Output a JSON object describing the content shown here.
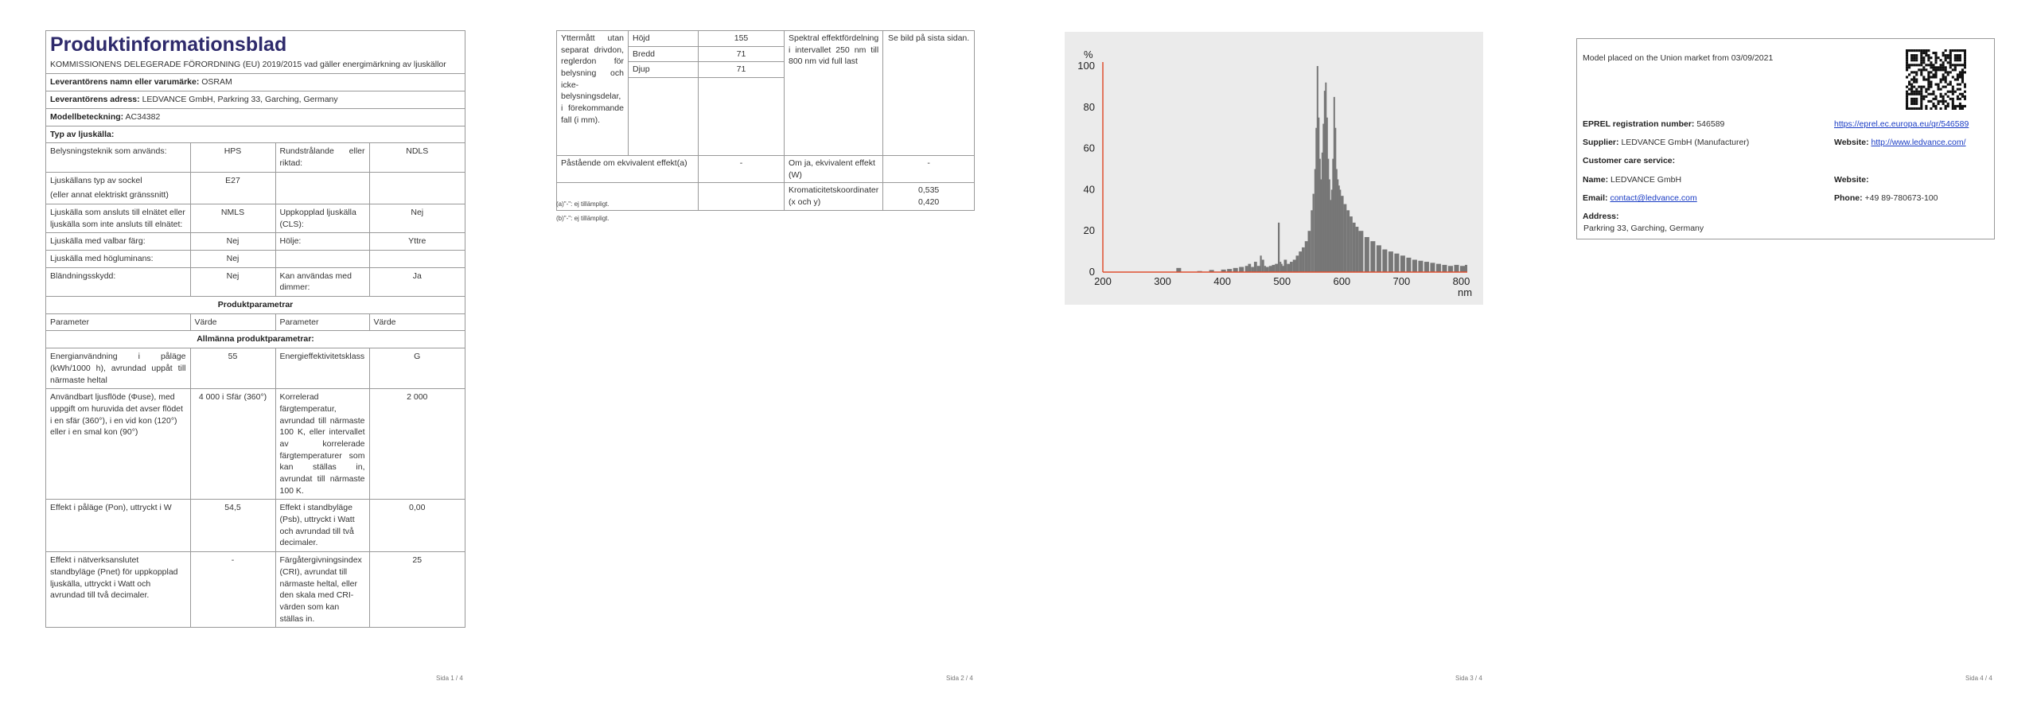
{
  "page1": {
    "title": "Produktinformationsblad",
    "intro": "KOMMISSIONENS DELEGERADE FÖRORDNING (EU) 2019/2015 vad gäller energimärkning av ljuskällor",
    "supplier_label": "Leverantörens namn eller varumärke:",
    "supplier_value": "OSRAM",
    "address_label": "Leverantörens adress:",
    "address_value": "LEDVANCE GmbH, Parkring 33, Garching, Germany",
    "model_label": "Modellbeteckning:",
    "model_value": "AC34382",
    "type_heading": "Typ av ljuskälla:",
    "type_rows": [
      {
        "l1": "Belysningsteknik som används:",
        "v1": "HPS",
        "l2": "Rundstrålande eller riktad:",
        "v2": "NDLS"
      },
      {
        "l1": "Ljuskällans typ av sockel",
        "l1b": "(eller annat elektriskt gränssnitt)",
        "v1": "E27",
        "l2": "",
        "v2": ""
      },
      {
        "l1": "Ljuskälla som ansluts till elnätet eller ljuskälla som inte ansluts till elnätet:",
        "v1": "NMLS",
        "l2": "Uppkopplad ljuskälla (CLS):",
        "v2": "Nej"
      },
      {
        "l1": "Ljuskälla med valbar färg:",
        "v1": "Nej",
        "l2": "Hölje:",
        "v2": "Yttre"
      },
      {
        "l1": "Ljuskälla med högluminans:",
        "v1": "Nej",
        "l2": "",
        "v2": ""
      },
      {
        "l1": "Bländningsskydd:",
        "v1": "Nej",
        "l2": "Kan användas med dimmer:",
        "v2": "Ja"
      }
    ],
    "params_heading": "Produktparametrar",
    "col_param": "Parameter",
    "col_value": "Värde",
    "general_heading": "Allmänna produktparametrar:",
    "param_rows": [
      {
        "l1": "Energianvändning i påläge (kWh/1000 h), avrundad uppåt till närmaste heltal",
        "v1": "55",
        "l2": "Energieffektivitetsklass",
        "v2": "G"
      },
      {
        "l1": "Användbart ljusflöde (Φuse), med uppgift om huruvida det avser flödet i en sfär (360°), i en vid kon (120°) eller i en smal kon (90°)",
        "v1": "4 000 i Sfär (360°)",
        "l2": "Korrelerad färgtemperatur, avrundad till närmaste 100 K, eller intervallet av korrelerade färgtemperaturer som kan ställas in, avrundat till närmaste 100 K.",
        "v2": "2 000"
      },
      {
        "l1": "Effekt i påläge (Pon), uttryckt i W",
        "v1": "54,5",
        "l2": "Effekt i standbyläge (Psb), uttryckt i Watt och avrundad till två decimaler.",
        "v2": "0,00"
      },
      {
        "l1": "Effekt i nätverksanslutet standbyläge (Pnet) för uppkopplad ljuskälla, uttryckt i Watt och avrundad till två decimaler.",
        "v1": "-",
        "l2": "Färgåtergivningsindex (CRI), avrundat till närmaste heltal, eller den skala med CRI-värden som kan ställas in.",
        "v2": "25"
      }
    ],
    "page_number": "Sida 1 / 4"
  },
  "page2": {
    "dims_label": "Yttermått utan separat drivdon, reglerdon för belysning och icke-belysningsdelar, i förekommande fall (i mm).",
    "dims": [
      {
        "name": "Höjd",
        "value": "155"
      },
      {
        "name": "Bredd",
        "value": "71"
      },
      {
        "name": "Djup",
        "value": "71"
      }
    ],
    "spectral_label": "Spektral effektfördelning i intervallet 250 nm till 800 nm vid full last",
    "spectral_value": "Se bild på sista sidan.",
    "equiv_claim_label": "Påstående om ekvivalent effekt(a)",
    "equiv_claim_value": "-",
    "equiv_power_label": "Om ja, ekvivalent effekt (W)",
    "equiv_power_value": "-",
    "chroma_label": "Kromaticitetskoordinater (x och y)",
    "chroma_x": "0,535",
    "chroma_y": "0,420",
    "footnote_a": "(a)\"-\": ej tillämpligt.",
    "footnote_b": "(b)\"-\": ej tillämpligt.",
    "page_number": "Sida 2 / 4"
  },
  "chart_data": {
    "type": "area",
    "title": "",
    "xlabel": "nm",
    "ylabel": "%",
    "xlim": [
      200,
      810
    ],
    "ylim": [
      0,
      100
    ],
    "xticks": [
      200,
      300,
      400,
      500,
      600,
      700,
      800
    ],
    "yticks": [
      0,
      20,
      40,
      60,
      80,
      100
    ],
    "grid": false,
    "x": [
      325,
      360,
      380,
      400,
      410,
      420,
      430,
      440,
      445,
      450,
      455,
      460,
      465,
      468,
      472,
      475,
      480,
      485,
      490,
      495,
      498,
      500,
      502,
      505,
      510,
      515,
      520,
      525,
      530,
      535,
      540,
      545,
      550,
      553,
      556,
      558,
      560,
      562,
      564,
      566,
      568,
      570,
      572,
      574,
      576,
      578,
      580,
      582,
      584,
      586,
      588,
      590,
      592,
      594,
      596,
      598,
      600,
      605,
      610,
      615,
      620,
      625,
      630,
      640,
      650,
      660,
      670,
      680,
      690,
      700,
      710,
      720,
      730,
      740,
      750,
      760,
      770,
      780,
      790,
      800,
      808
    ],
    "values": [
      2,
      0.5,
      1,
      1.2,
      1.5,
      2,
      2.5,
      3,
      4,
      2.5,
      5,
      3,
      8,
      6,
      3,
      2.5,
      3,
      3.5,
      4,
      24,
      5,
      4,
      3,
      6,
      4,
      5,
      6,
      8,
      10,
      12,
      15,
      20,
      30,
      38,
      50,
      70,
      100,
      75,
      55,
      45,
      58,
      72,
      88,
      92,
      75,
      55,
      45,
      35,
      40,
      55,
      85,
      70,
      50,
      45,
      42,
      40,
      37,
      33,
      30,
      27,
      24,
      22,
      20,
      17,
      15,
      13,
      11,
      10,
      9,
      8,
      7,
      6,
      5.5,
      5,
      4.5,
      4,
      3.5,
      3,
      3.5,
      3,
      3.5
    ],
    "color": "#777777",
    "axis_color": "#e05030"
  },
  "page3": {
    "page_number": "Sida 3 / 4"
  },
  "page4": {
    "placed": "Model placed on the Union market from 03/09/2021",
    "eprel_label": "EPREL registration number:",
    "eprel_value": "546589",
    "eprel_url": "https://eprel.ec.europa.eu/qr/546589",
    "supplier_label": "Supplier:",
    "supplier_value": "LEDVANCE GmbH (Manufacturer)",
    "website_label": "Website:",
    "website_value": "http://www.ledvance.com/",
    "care_heading": "Customer care service:",
    "name_label": "Name:",
    "name_value": "LEDVANCE GmbH",
    "care_website_label": "Website:",
    "email_label": "Email:",
    "email_value": "contact@ledvance.com",
    "phone_label": "Phone:",
    "phone_value": "+49 89-780673-100",
    "address_label": "Address:",
    "address_value": "Parkring 33, Garching, Germany",
    "page_number": "Sida 4 / 4"
  }
}
